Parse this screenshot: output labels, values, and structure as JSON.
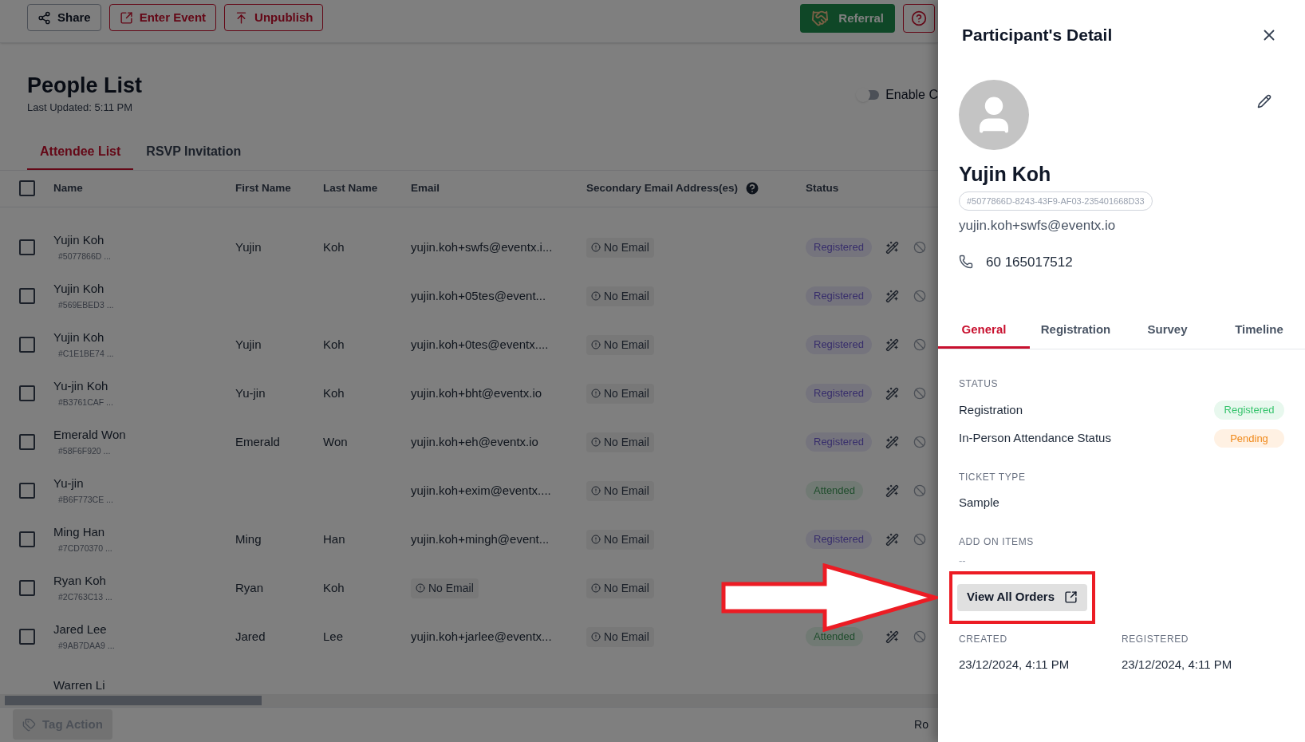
{
  "toolbar": {
    "buttons": [
      {
        "label": "Share",
        "kind": "share"
      },
      {
        "label": "Enter Event",
        "kind": "enter"
      },
      {
        "label": "Unpublish",
        "kind": "unpublish"
      }
    ],
    "referral": "Referral"
  },
  "page": {
    "title": "People List",
    "last_updated": "Last Updated: 5:11 PM",
    "toggle": {
      "label": "Enable C",
      "on": false
    },
    "tabs": [
      {
        "label": "Attendee List",
        "selected": true
      },
      {
        "label": "RSVP Invitation",
        "selected": false
      }
    ]
  },
  "table": {
    "select_all_checked": false,
    "columns": [
      "Name",
      "First Name",
      "Last Name",
      "Email",
      "Secondary Email Address(es)",
      "Status"
    ],
    "rows": [
      {
        "name": "Yujin Koh",
        "id": "#5077866D ...",
        "first_name": "Yujin",
        "last_name": "Koh",
        "email": {
          "text": "yujin.koh+swfs@eventx.i...",
          "kind": "plain"
        },
        "secondary": "No Email",
        "status": {
          "label": "Registered",
          "kind": "registered"
        },
        "checked": false
      },
      {
        "name": "Yujin Koh",
        "id": "#569EBED3 ...",
        "first_name": "",
        "last_name": "",
        "email": {
          "text": "yujin.koh+05tes@event...",
          "kind": "plain"
        },
        "secondary": "No Email",
        "status": {
          "label": "Registered",
          "kind": "registered"
        },
        "checked": false
      },
      {
        "name": "Yujin Koh",
        "id": "#C1E1BE74 ...",
        "first_name": "Yujin",
        "last_name": "Koh",
        "email": {
          "text": "yujin.koh+0tes@eventx....",
          "kind": "plain"
        },
        "secondary": "No Email",
        "status": {
          "label": "Registered",
          "kind": "registered"
        },
        "checked": false
      },
      {
        "name": "Yu-jin Koh",
        "id": "#B3761CAF ...",
        "first_name": "Yu-jin",
        "last_name": "Koh",
        "email": {
          "text": "yujin.koh+bht@eventx.io",
          "kind": "plain"
        },
        "secondary": "No Email",
        "status": {
          "label": "Registered",
          "kind": "registered"
        },
        "checked": false
      },
      {
        "name": "Emerald Won",
        "id": "#58F6F920 ...",
        "first_name": "Emerald",
        "last_name": "Won",
        "email": {
          "text": "yujin.koh+eh@eventx.io",
          "kind": "plain"
        },
        "secondary": "No Email",
        "status": {
          "label": "Registered",
          "kind": "registered"
        },
        "checked": false
      },
      {
        "name": "Yu-jin",
        "id": "#B6F773CE ...",
        "first_name": "",
        "last_name": "",
        "email": {
          "text": "yujin.koh+exim@eventx....",
          "kind": "plain"
        },
        "secondary": "No Email",
        "status": {
          "label": "Attended",
          "kind": "attended"
        },
        "checked": false
      },
      {
        "name": "Ming Han",
        "id": "#7CD70370 ...",
        "first_name": "Ming",
        "last_name": "Han",
        "email": {
          "text": "yujin.koh+mingh@event...",
          "kind": "plain"
        },
        "secondary": "No Email",
        "status": {
          "label": "Registered",
          "kind": "registered"
        },
        "checked": false
      },
      {
        "name": "Ryan Koh",
        "id": "#2C763C13 ...",
        "first_name": "Ryan",
        "last_name": "Koh",
        "email": {
          "text": "No Email",
          "kind": "missing"
        },
        "secondary": "No Email",
        "checked": false
      },
      {
        "name": "Jared Lee",
        "id": "#9AB7DAA9 ...",
        "first_name": "Jared",
        "last_name": "Lee",
        "email": {
          "text": "yujin.koh+jarlee@eventx...",
          "kind": "plain"
        },
        "secondary": "No Email",
        "status": {
          "label": "Attended",
          "kind": "attended"
        },
        "checked": false
      },
      {
        "name": "Warren Li"
      }
    ]
  },
  "footer": {
    "tag_action": {
      "label": "Tag Action",
      "disabled": true
    },
    "right_text": "Ro"
  },
  "panel": {
    "title": "Participant's Detail",
    "name": "Yujin Koh",
    "id": "#5077866D-8243-43F9-AF03-235401668D33",
    "email": "yujin.koh+swfs@eventx.io",
    "phone": "60 165017512",
    "tabs": [
      {
        "label": "General",
        "selected": true
      },
      {
        "label": "Registration",
        "selected": false
      },
      {
        "label": "Survey",
        "selected": false
      },
      {
        "label": "Timeline",
        "selected": false
      }
    ],
    "status_heading": "STATUS",
    "statuses": [
      {
        "label": "Registration",
        "value": "Registered",
        "kind": "success"
      },
      {
        "label": "In-Person Attendance Status",
        "value": "Pending",
        "kind": "pending"
      }
    ],
    "ticket_heading": "TICKET TYPE",
    "ticket": "Sample",
    "addon_heading": "ADD ON ITEMS",
    "addon": "--",
    "orders_button": "View All Orders",
    "dates": [
      {
        "heading": "CREATED",
        "value": "23/12/2024, 4:11 PM"
      },
      {
        "heading": "REGISTERED",
        "value": "23/12/2024, 4:11 PM"
      }
    ]
  }
}
